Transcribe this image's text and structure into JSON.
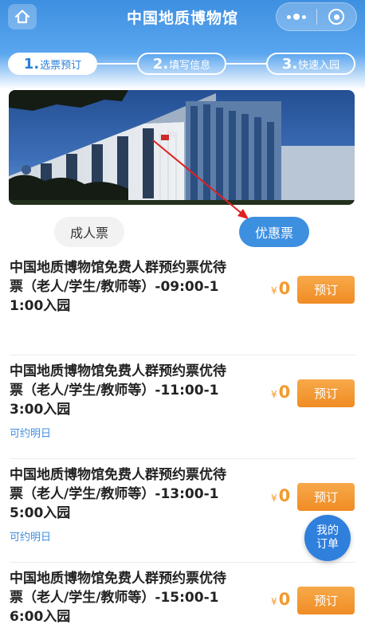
{
  "header": {
    "title": "中国地质博物馆",
    "home_icon": "home-icon",
    "more_icon": "more-dots-icon",
    "close_icon": "target-circle-icon"
  },
  "steps": [
    {
      "num": "1.",
      "label": "选票预订",
      "active": true
    },
    {
      "num": "2.",
      "label": "填写信息",
      "active": false
    },
    {
      "num": "3.",
      "label": "快速入园",
      "active": false
    }
  ],
  "ticket_tabs": {
    "adult": "成人票",
    "discount": "优惠票",
    "selected": "优惠票"
  },
  "tickets": [
    {
      "name": "中国地质博物馆免费人群预约票优待票（老人/学生/教师等）-09:00-11:00入园",
      "note": "",
      "yen": "¥",
      "price": "0",
      "book": "预订"
    },
    {
      "name": "中国地质博物馆免费人群预约票优待票（老人/学生/教师等）-11:00-13:00入园",
      "note": "可约明日",
      "yen": "¥",
      "price": "0",
      "book": "预订"
    },
    {
      "name": "中国地质博物馆免费人群预约票优待票（老人/学生/教师等）-13:00-15:00入园",
      "note": "可约明日",
      "yen": "¥",
      "price": "0",
      "book": "预订"
    },
    {
      "name": "中国地质博物馆免费人群预约票优待票（老人/学生/教师等）-15:00-16:00入园",
      "note": "",
      "yen": "¥",
      "price": "0",
      "book": "预订"
    }
  ],
  "floating": {
    "line1": "我的",
    "line2": "订单"
  },
  "colors": {
    "primary": "#3d8fe0",
    "accent": "#f39a2e",
    "annotation": "#e02020"
  }
}
